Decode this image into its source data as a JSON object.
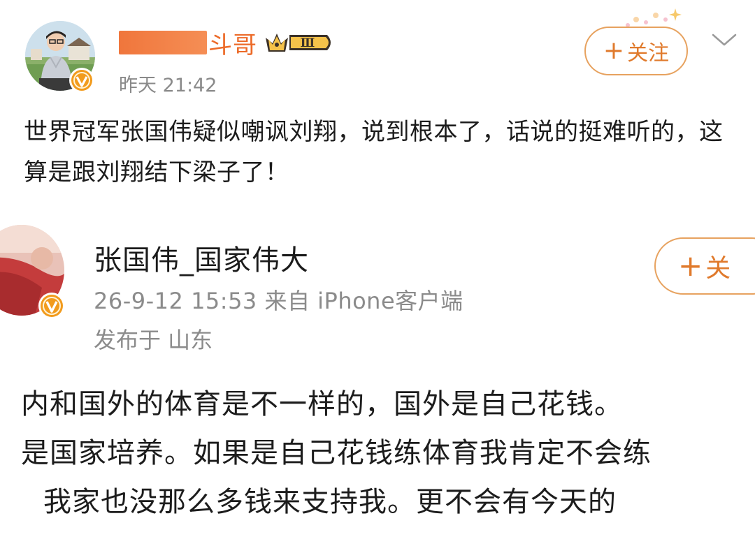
{
  "post": {
    "author": {
      "name_visible": "斗哥",
      "avatar_icon": "avatar-icon",
      "verified_icon": "verified-badge-icon",
      "level_badge": "Ⅲ"
    },
    "time": "昨天 21:42",
    "follow_label": "关注",
    "follow_plus": "+",
    "body": "世界冠军张国伟疑似嘲讽刘翔，说到根本了，话说的挺难听的，这算是跟刘翔结下梁子了！"
  },
  "quoted": {
    "author": {
      "name": "张国伟_国家伟大",
      "avatar_icon": "avatar-icon",
      "verified_icon": "verified-badge-icon"
    },
    "meta": "26-9-12 15:53  来自 iPhone客户端",
    "location": "发布于 山东",
    "follow_label": "关",
    "follow_plus": "+",
    "body_lines": [
      "内和国外的体育是不一样的，国外是自己花钱。",
      "是国家培养。如果是自己花钱练体育我肯定不会练",
      "我家也没那么多钱来支持我。更不会有今天的"
    ]
  },
  "colors": {
    "accent_orange": "#e07a2c",
    "follow_border": "#e7a25f",
    "meta_gray": "#8a8a8a",
    "verified_orange": "#f29b1d"
  }
}
